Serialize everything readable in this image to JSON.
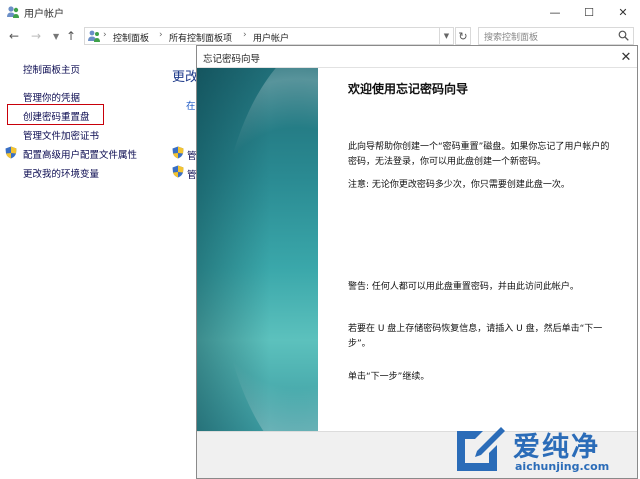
{
  "window": {
    "title": "用户帐户",
    "controls": {
      "minimize": "—",
      "maximize": "☐",
      "close": "✕"
    }
  },
  "address_bar": {
    "breadcrumbs": [
      "控制面板",
      "所有控制面板项",
      "用户帐户"
    ],
    "separator": "›",
    "search_placeholder": "搜索控制面板"
  },
  "left_pane": {
    "links": {
      "home": "控制面板主页",
      "credentials": "管理你的凭据",
      "create_reset_disk": "创建密码重置盘",
      "file_encryption_cert": "管理文件加密证书",
      "advanced_profile": "配置高级用户配置文件属性",
      "environment_vars": "更改我的环境变量"
    },
    "highlight_color": "#c8000a"
  },
  "main_pane": {
    "heading_fragment": "更改",
    "fragment_1": "在",
    "fragment_2": "管",
    "fragment_3": "管"
  },
  "wizard": {
    "title": "忘记密码向导",
    "close": "✕",
    "heading": "欢迎使用忘记密码向导",
    "paragraphs": [
      "此向导帮助你创建一个“密码重置”磁盘。如果你忘记了用户帐户的密码，无法登录，你可以用此盘创建一个新密码。",
      "注意: 无论你更改密码多少次，你只需要创建此盘一次。",
      "警告: 任何人都可以用此盘重置密码，并由此访问此帐户。",
      "若要在 U 盘上存储密码恢复信息，请插入 U 盘，然后单击“下一步”。",
      "单击“下一步”继续。"
    ],
    "banner_colors": [
      "#1f6d77",
      "#3aa7aa",
      "#5cc1bd"
    ]
  },
  "watermark": {
    "text": "爱纯净",
    "url": "aichunjing.com",
    "color": "#2b6cb8"
  }
}
